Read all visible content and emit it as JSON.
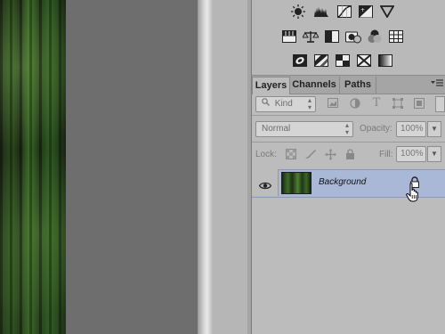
{
  "layers_panel": {
    "tabs": [
      {
        "label": "Layers"
      },
      {
        "label": "Channels"
      },
      {
        "label": "Paths"
      }
    ],
    "filter": {
      "kind_label": "Kind"
    },
    "blend_mode": "Normal",
    "opacity_label": "Opacity:",
    "opacity_value": "100%",
    "lock_label": "Lock:",
    "fill_label": "Fill:",
    "fill_value": "100%",
    "layers": [
      {
        "name": "Background",
        "visible": true,
        "locked": true
      }
    ]
  },
  "colors": {
    "pasteboard": "#6e6e6e",
    "panel_bg": "#bcbcbc",
    "selected_row": "#a8b8d6"
  },
  "adjustment_icons": [
    "brightness-contrast-icon",
    "levels-icon",
    "curves-icon",
    "exposure-icon",
    "vibrance-icon",
    "hue-saturation-icon",
    "color-balance-icon",
    "black-white-icon",
    "photo-filter-icon",
    "channel-mixer-icon",
    "color-lookup-icon",
    "invert-icon",
    "posterize-icon",
    "threshold-icon",
    "selective-color-icon",
    "gradient-map-icon"
  ]
}
